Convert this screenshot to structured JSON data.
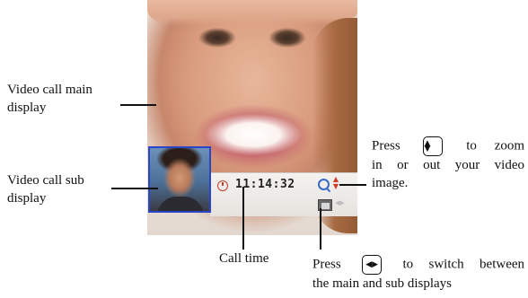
{
  "screen": {
    "call_time": "11:14:32",
    "icons": [
      "timer-icon",
      "zoom-icon",
      "zoom-arrows-icon",
      "switch-display-icon",
      "switch-arrows-icon"
    ],
    "sub_video_border_color": "#2a45c8"
  },
  "annotations": {
    "main_display_line1": "Video call main",
    "main_display_line2": "display",
    "sub_display_line1": "Video call sub",
    "sub_display_line2": "display",
    "call_time_label": "Call time",
    "zoom_press": "Press",
    "zoom_to": "to",
    "zoom_zoom": "zoom",
    "zoom_line2": "in or out your video",
    "zoom_line3": "image.",
    "switch_press": "Press",
    "switch_text": "to switch between",
    "switch_line2": "the main and sub displays"
  }
}
